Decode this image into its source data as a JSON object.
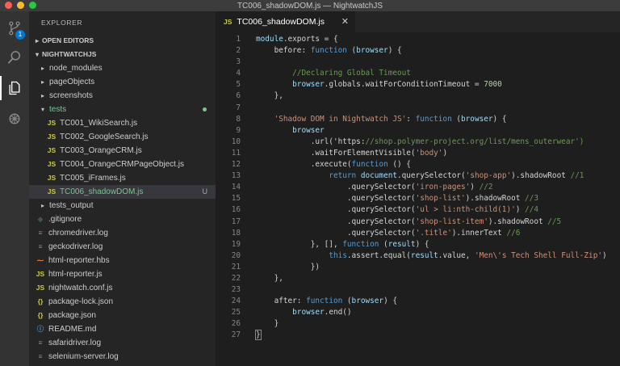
{
  "window": {
    "title": "TC006_shadowDOM.js — NightwatchJS"
  },
  "activity_bar": {
    "scm_badge": "1"
  },
  "explorer": {
    "title": "EXPLORER",
    "open_editors": "OPEN EDITORS",
    "project": "NIGHTWATCHJS",
    "items": [
      {
        "label": "node_modules",
        "kind": "folder",
        "icon": ""
      },
      {
        "label": "pageObjects",
        "kind": "folder",
        "icon": ""
      },
      {
        "label": "screenshots",
        "kind": "folder",
        "icon": ""
      },
      {
        "label": "tests",
        "kind": "folder-open",
        "icon": ""
      },
      {
        "label": "TC001_WikiSearch.js",
        "kind": "file",
        "icon": "JS"
      },
      {
        "label": "TC002_GoogleSearch.js",
        "kind": "file",
        "icon": "JS"
      },
      {
        "label": "TC003_OrangeCRM.js",
        "kind": "file",
        "icon": "JS"
      },
      {
        "label": "TC004_OrangeCRMPageObject.js",
        "kind": "file",
        "icon": "JS"
      },
      {
        "label": "TC005_iFrames.js",
        "kind": "file",
        "icon": "JS"
      },
      {
        "label": "TC006_shadowDOM.js",
        "kind": "file",
        "icon": "JS",
        "decoration": "U"
      },
      {
        "label": "tests_output",
        "kind": "folder",
        "icon": ""
      },
      {
        "label": ".gitignore",
        "kind": "file",
        "icon": "◆"
      },
      {
        "label": "chromedriver.log",
        "kind": "file",
        "icon": "≡"
      },
      {
        "label": "geckodriver.log",
        "kind": "file",
        "icon": "≡"
      },
      {
        "label": "html-reporter.hbs",
        "kind": "file",
        "icon": "⁓"
      },
      {
        "label": "html-reporter.js",
        "kind": "file",
        "icon": "JS"
      },
      {
        "label": "nightwatch.conf.js",
        "kind": "file",
        "icon": "JS"
      },
      {
        "label": "package-lock.json",
        "kind": "file",
        "icon": "{}"
      },
      {
        "label": "package.json",
        "kind": "file",
        "icon": "{}"
      },
      {
        "label": "README.md",
        "kind": "file",
        "icon": "ⓘ"
      },
      {
        "label": "safaridriver.log",
        "kind": "file",
        "icon": "≡"
      },
      {
        "label": "selenium-server.log",
        "kind": "file",
        "icon": "≡"
      }
    ]
  },
  "editor": {
    "tab": {
      "icon": "JS",
      "label": "TC006_shadowDOM.js",
      "close": "✕"
    },
    "lines": [
      "module.exports = {",
      "    before: function (browser) {",
      "",
      "        //Declaring Global Timeout",
      "        browser.globals.waitForConditionTimeout = 7000",
      "    },",
      "",
      "    'Shadow DOM in Nightwatch JS': function (browser) {",
      "        browser",
      "            .url('https://shop.polymer-project.org/list/mens_outerwear')",
      "            .waitForElementVisible('body')",
      "            .execute(function () {",
      "                return document.querySelector('shop-app').shadowRoot //1",
      "                    .querySelector('iron-pages') //2",
      "                    .querySelector('shop-list').shadowRoot //3",
      "                    .querySelector('ul > li:nth-child(1)') //4",
      "                    .querySelector('shop-list-item').shadowRoot //5",
      "                    .querySelector('.title').innerText //6",
      "            }, [], function (result) {",
      "                this.assert.equal(result.value, 'Men\\'s Tech Shell Full-Zip')",
      "            })",
      "    },",
      "",
      "    after: function (browser) {",
      "        browser.end()",
      "    }",
      "}"
    ]
  },
  "colors": {
    "accent": "#007acc",
    "untracked": "#73c991",
    "js_icon": "#cbcb41"
  }
}
